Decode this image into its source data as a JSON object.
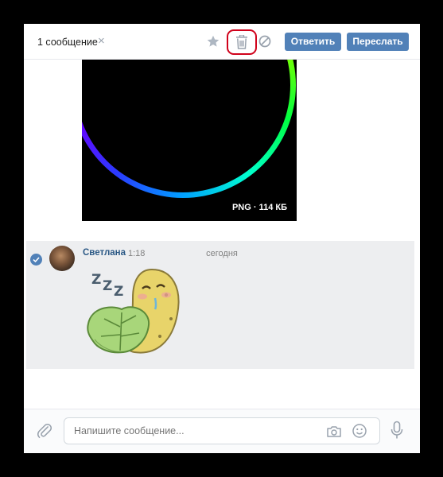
{
  "header": {
    "selected_count": "1 сообщение",
    "clear_icon": "×",
    "reply_label": "Ответить",
    "forward_label": "Переслать",
    "icons": [
      "star-icon",
      "trash-icon",
      "block-icon"
    ],
    "highlight_color": "#d0021b"
  },
  "media_message": {
    "file_type": "PNG",
    "file_size": "114 КБ",
    "file_meta": "PNG · 114 КБ"
  },
  "date_separator": "сегодня",
  "selected_message": {
    "author": "Светлана",
    "time": "1:18",
    "sticker": "sleeping-pickle-sticker",
    "selected": true
  },
  "composer": {
    "placeholder": "Напишите сообщение...",
    "icons": [
      "attach-icon",
      "camera-icon",
      "smile-icon",
      "mic-icon"
    ]
  },
  "colors": {
    "accent": "#5181b8",
    "author_link": "#2a5885",
    "selected_bg": "#edeef0"
  }
}
